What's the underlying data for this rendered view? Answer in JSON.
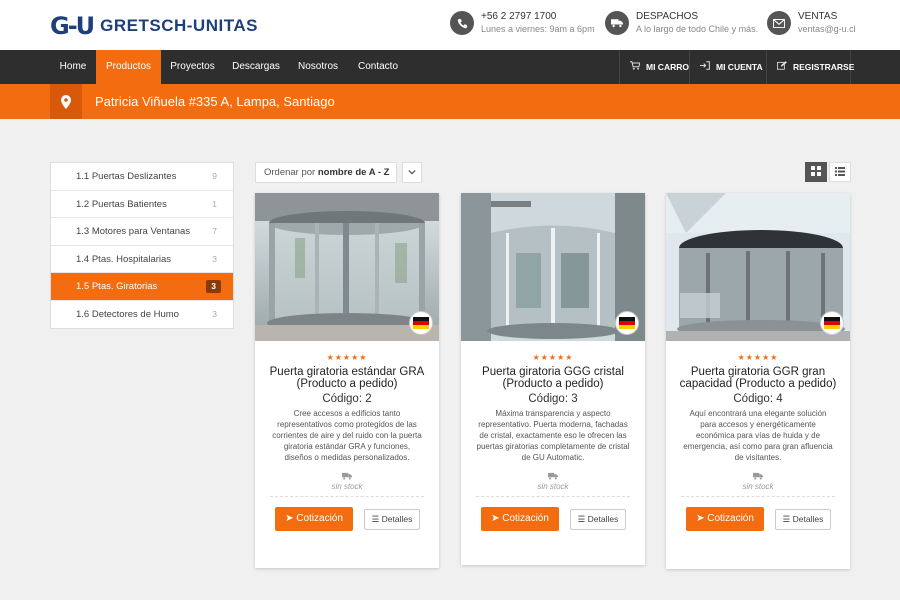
{
  "brand": {
    "mark": "G-U",
    "name": "GRETSCH-UNITAS"
  },
  "contacts": [
    {
      "icon": "phone-icon",
      "title": "+56 2 2797 1700",
      "subtitle": "Lunes a viernes: 9am a 6pm"
    },
    {
      "icon": "truck-icon",
      "title": "DESPACHOS",
      "subtitle": "A lo largo de todo Chile y más."
    },
    {
      "icon": "mail-icon",
      "title": "VENTAS",
      "subtitle": "ventas@g-u.cl"
    }
  ],
  "nav": {
    "items": [
      "Home",
      "Productos",
      "Proyectos",
      "Descargas",
      "Nosotros",
      "Contacto"
    ],
    "active": "Productos",
    "right": [
      "MI CARRO",
      "MI CUENTA",
      "REGISTRARSE"
    ]
  },
  "address": "Patricia Viñuela #335 A, Lampa, Santiago",
  "sidebar": {
    "items": [
      {
        "label": "1.1 Puertas Deslizantes",
        "count": "9"
      },
      {
        "label": "1.2 Puertas Batientes",
        "count": "1"
      },
      {
        "label": "1.3 Motores para Ventanas",
        "count": "7"
      },
      {
        "label": "1.4 Ptas. Hospitalarias",
        "count": "3"
      },
      {
        "label": "1.5 Ptas. Giratorias",
        "count": "3"
      },
      {
        "label": "1.6 Detectores de Humo",
        "count": "3"
      }
    ],
    "active_index": 4
  },
  "sort": {
    "prefix": "Ordenar por",
    "value": "nombre de A - Z"
  },
  "products": [
    {
      "title": "Puerta giratoria estándar GRA (Producto a pedido)",
      "code": "Código: 2",
      "description": "Cree accesos a edificios tanto representativos como protegidos de las corrientes de aire y del ruido con la puerta giratoria estándar GRA y funciones, diseños o medidas personalizados.",
      "stock": "sin stock",
      "rating": "★★★★★",
      "quote_label": "Cotización",
      "details_label": "Detalles"
    },
    {
      "title": "Puerta giratoria GGG cristal (Producto a pedido)",
      "code": "Código: 3",
      "description": "Máxima transparencia y aspecto representativo. Puerta moderna, fachadas de cristal, exactamente eso le ofrecen las puertas giratorias completamente de cristal de GU Automatic.",
      "stock": "sin stock",
      "rating": "★★★★★",
      "quote_label": "Cotización",
      "details_label": "Detalles"
    },
    {
      "title": "Puerta giratoria GGR gran capacidad (Producto a pedido)",
      "code": "Código: 4",
      "description": "Aquí encontrará una elegante solución para accesos y energéticamente económica para vías de huida y de emergencia, así como para gran afluencia de visitantes.",
      "stock": "sin stock",
      "rating": "★★★★★",
      "quote_label": "Cotización",
      "details_label": "Detalles"
    }
  ],
  "colors": {
    "accent": "#f36c10",
    "nav_bg": "#2e2e2e",
    "brand": "#1f3f7a"
  }
}
